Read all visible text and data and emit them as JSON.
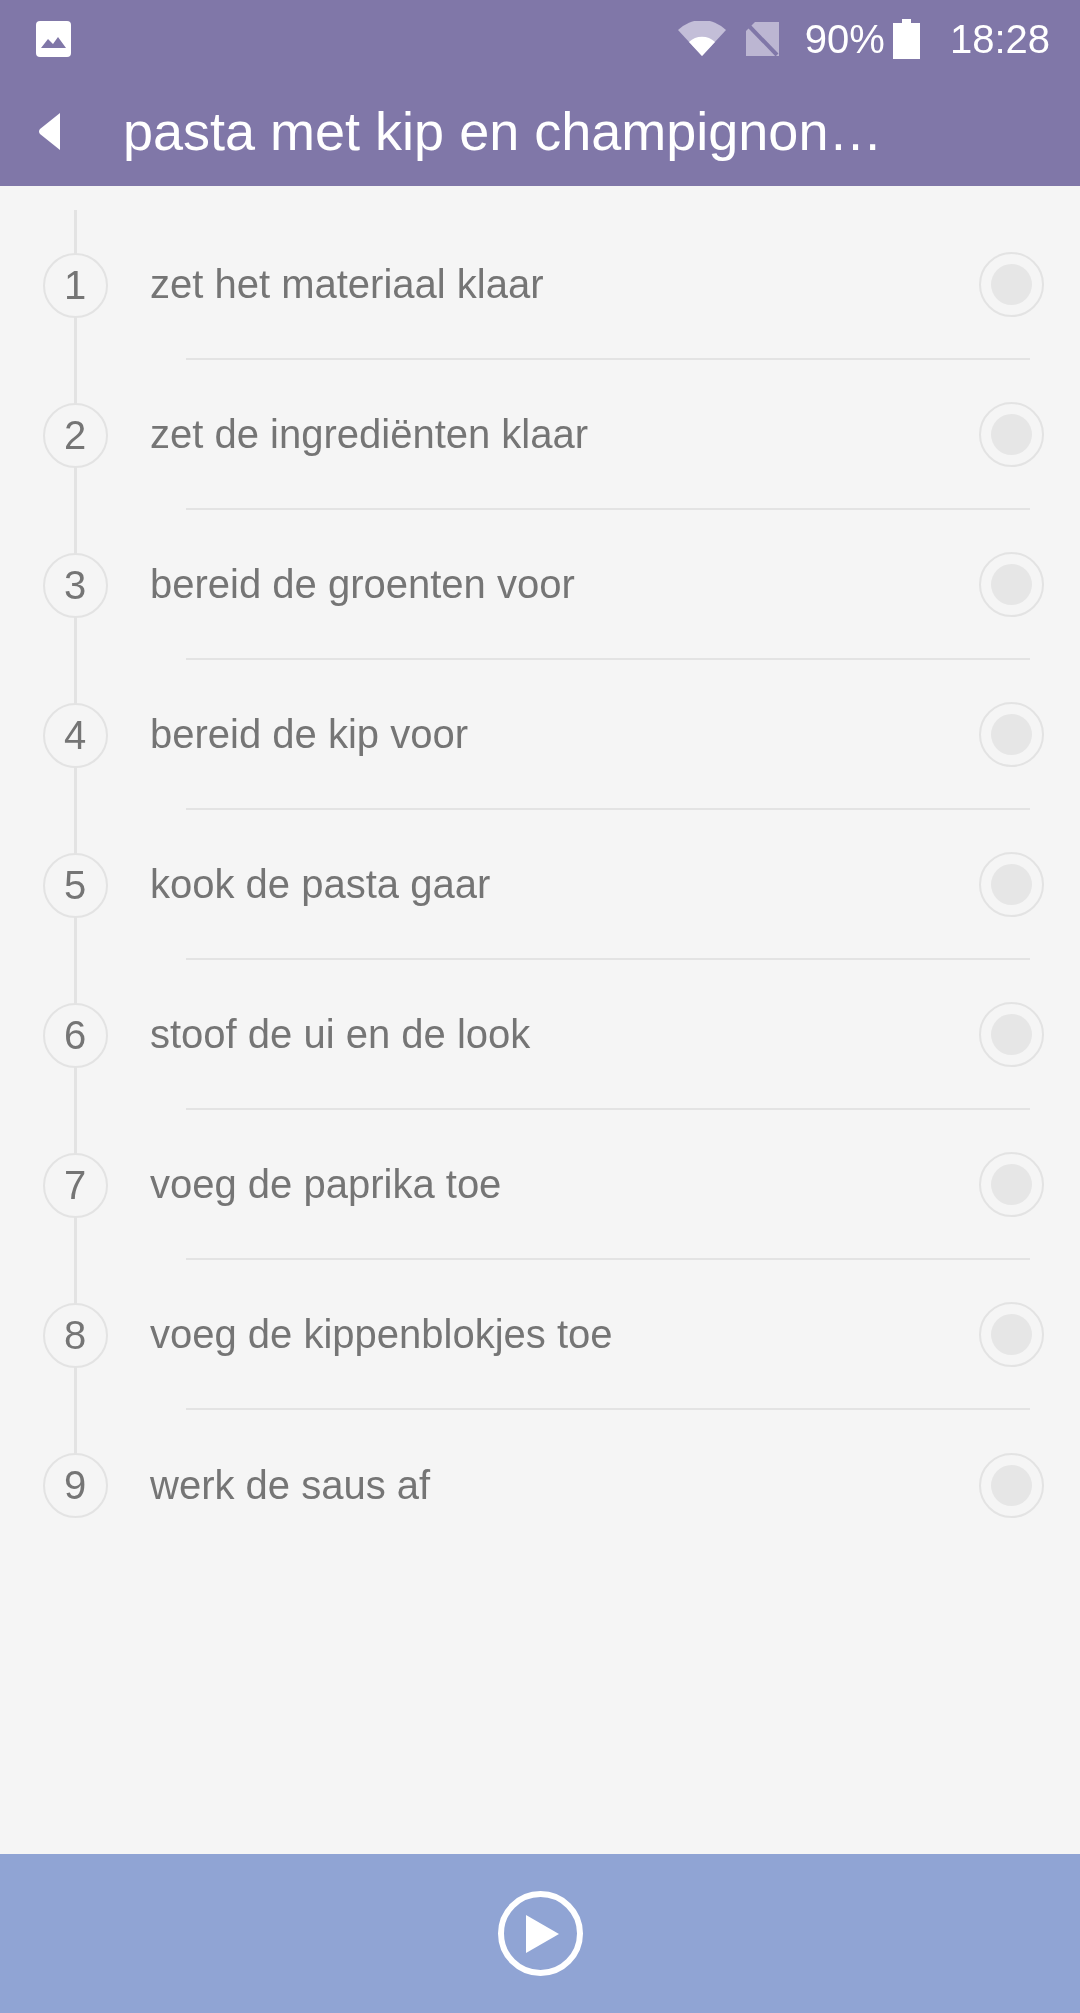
{
  "status_bar": {
    "battery": "90%",
    "time": "18:28"
  },
  "app_bar": {
    "title": "pasta met kip en champignon…"
  },
  "steps": [
    {
      "number": "1",
      "text": "zet het materiaal klaar",
      "checked": false
    },
    {
      "number": "2",
      "text": "zet de ingrediënten klaar",
      "checked": false
    },
    {
      "number": "3",
      "text": "bereid de groenten voor",
      "checked": false
    },
    {
      "number": "4",
      "text": "bereid de kip voor",
      "checked": false
    },
    {
      "number": "5",
      "text": "kook de pasta gaar",
      "checked": false
    },
    {
      "number": "6",
      "text": "stoof de ui en de look",
      "checked": false
    },
    {
      "number": "7",
      "text": "voeg de paprika toe",
      "checked": false
    },
    {
      "number": "8",
      "text": "voeg de kippenblokjes toe",
      "checked": false
    },
    {
      "number": "9",
      "text": "werk de saus af",
      "checked": false
    }
  ]
}
